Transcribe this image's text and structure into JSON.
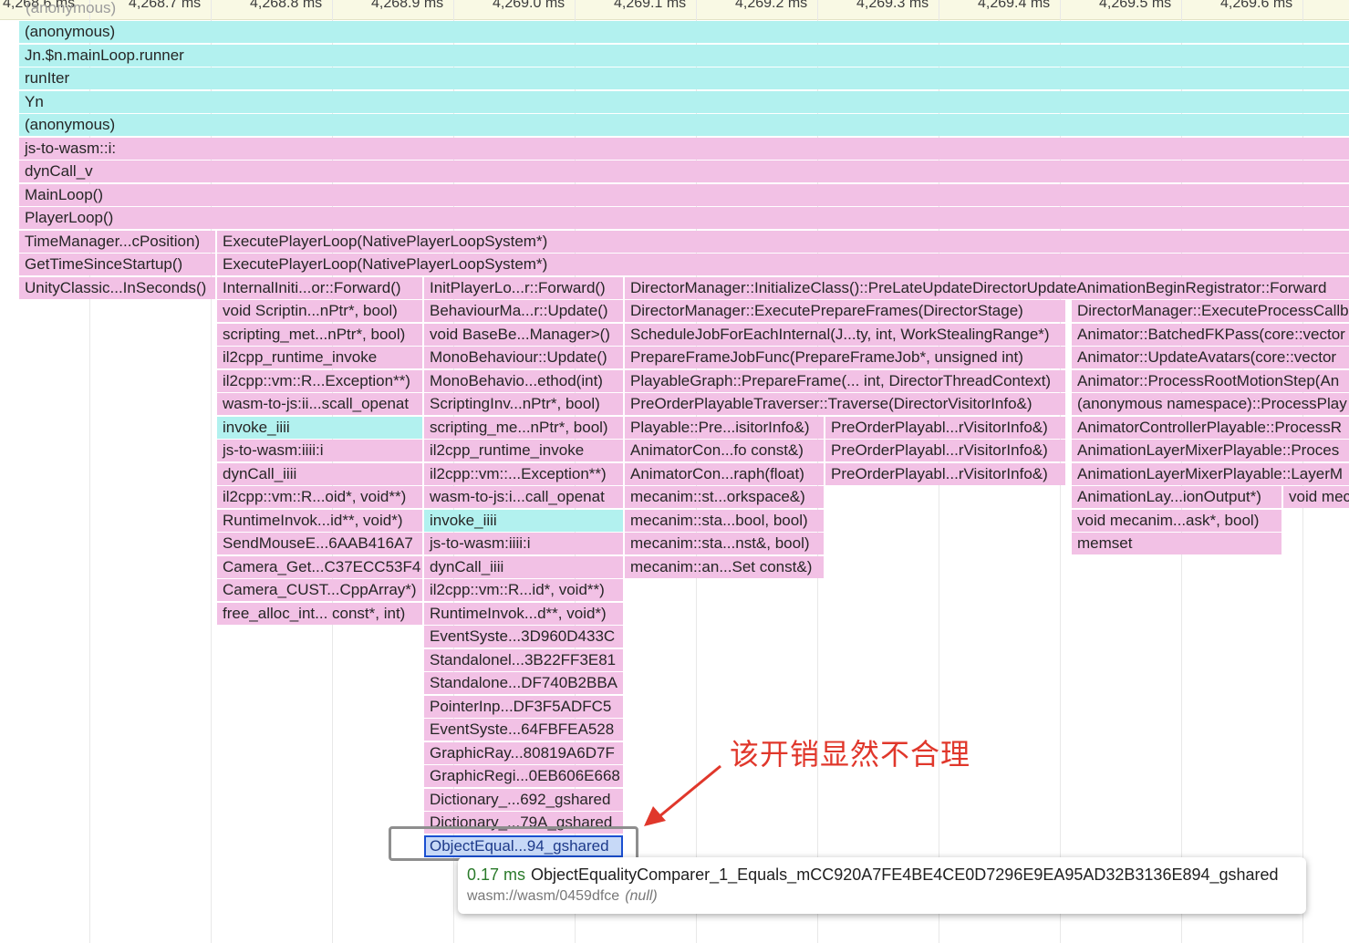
{
  "ruler": {
    "ticks": [
      "4,268.6 ms",
      "4,268.7 ms",
      "4,268.8 ms",
      "4,268.9 ms",
      "4,269.0 ms",
      "4,269.1 ms",
      "4,269.2 ms",
      "4,269.3 ms",
      "4,269.4 ms",
      "4,269.5 ms",
      "4,269.6 ms"
    ]
  },
  "ghost_label": "(anonymous)",
  "flame": {
    "columns": {
      "c0": [
        {
          "label": "(anonymous)",
          "color": "cyan"
        },
        {
          "label": "Jn.$n.mainLoop.runner",
          "color": "cyan"
        },
        {
          "label": "runIter",
          "color": "cyan"
        },
        {
          "label": "Yn",
          "color": "cyan"
        },
        {
          "label": "(anonymous)",
          "color": "cyan"
        },
        {
          "label": "js-to-wasm::i:",
          "color": "pink"
        },
        {
          "label": "dynCall_v",
          "color": "pink"
        },
        {
          "label": "MainLoop()",
          "color": "pink"
        },
        {
          "label": "PlayerLoop()",
          "color": "pink"
        },
        {
          "label": "TimeManager...cPosition)",
          "color": "pink"
        },
        {
          "label": "GetTimeSinceStartup()",
          "color": "pink"
        },
        {
          "label": "UnityClassic...InSeconds()",
          "color": "pink"
        }
      ],
      "c1_top": [
        {
          "label": "ExecutePlayerLoop(NativePlayerLoopSystem*)",
          "color": "pink"
        },
        {
          "label": "ExecutePlayerLoop(NativePlayerLoopSystem*)",
          "color": "pink"
        }
      ],
      "c1": [
        {
          "label": "InternalIniti...or::Forward()",
          "color": "pink"
        },
        {
          "label": "void Scriptin...nPtr*, bool)",
          "color": "pink"
        },
        {
          "label": "scripting_met...nPtr*, bool)",
          "color": "pink"
        },
        {
          "label": "il2cpp_runtime_invoke",
          "color": "pink"
        },
        {
          "label": "il2cpp::vm::R...Exception**)",
          "color": "pink"
        },
        {
          "label": "wasm-to-js:ii...scall_openat",
          "color": "pink"
        },
        {
          "label": "invoke_iiii",
          "color": "cyan"
        },
        {
          "label": "js-to-wasm:iiii:i",
          "color": "pink"
        },
        {
          "label": "dynCall_iiii",
          "color": "pink"
        },
        {
          "label": "il2cpp::vm::R...oid*, void**)",
          "color": "pink"
        },
        {
          "label": "RuntimeInvok...id**, void*)",
          "color": "pink"
        },
        {
          "label": "SendMouseE...6AAB416A7",
          "color": "pink"
        },
        {
          "label": "Camera_Get...C37ECC53F4",
          "color": "pink"
        },
        {
          "label": "Camera_CUST...CppArray*)",
          "color": "pink"
        },
        {
          "label": "free_alloc_int... const*, int)",
          "color": "pink"
        }
      ],
      "c2": [
        {
          "label": "InitPlayerLo...r::Forward()",
          "color": "pink"
        },
        {
          "label": "BehaviourMa...r::Update()",
          "color": "pink"
        },
        {
          "label": "void BaseBe...Manager>()",
          "color": "pink"
        },
        {
          "label": "MonoBehaviour::Update()",
          "color": "pink"
        },
        {
          "label": "MonoBehavio...ethod(int)",
          "color": "pink"
        },
        {
          "label": "ScriptingInv...nPtr*, bool)",
          "color": "pink"
        },
        {
          "label": "scripting_me...nPtr*, bool)",
          "color": "pink"
        },
        {
          "label": "il2cpp_runtime_invoke",
          "color": "pink"
        },
        {
          "label": "il2cpp::vm::...Exception**)",
          "color": "pink"
        },
        {
          "label": "wasm-to-js:i...call_openat",
          "color": "pink"
        },
        {
          "label": "invoke_iiii",
          "color": "cyan"
        },
        {
          "label": "js-to-wasm:iiii:i",
          "color": "pink"
        },
        {
          "label": "dynCall_iiii",
          "color": "pink"
        },
        {
          "label": "il2cpp::vm::R...id*, void**)",
          "color": "pink"
        },
        {
          "label": "RuntimeInvok...d**, void*)",
          "color": "pink"
        },
        {
          "label": "EventSyste...3D960D433C",
          "color": "pink"
        },
        {
          "label": "Standalonel...3B22FF3E81",
          "color": "pink"
        },
        {
          "label": "Standalone...DF740B2BBA",
          "color": "pink"
        },
        {
          "label": "PointerInp...DF3F5ADFC5",
          "color": "pink"
        },
        {
          "label": "EventSyste...64FBFEA528",
          "color": "pink"
        },
        {
          "label": "GraphicRay...80819A6D7F",
          "color": "pink"
        },
        {
          "label": "GraphicRegi...0EB606E668",
          "color": "pink"
        },
        {
          "label": "Dictionary_...692_gshared",
          "color": "pink"
        },
        {
          "label": "Dictionary_...79A_gshared",
          "color": "pink"
        },
        {
          "label": "ObjectEqual...94_gshared",
          "color": "selected"
        }
      ],
      "c3_wide": [
        {
          "label": "DirectorManager::InitializeClass()::PreLateUpdateDirectorUpdateAnimationBeginRegistrator::Forward",
          "color": "pink"
        }
      ],
      "c3": [
        {
          "label": "DirectorManager::ExecutePrepareFrames(DirectorStage)",
          "color": "pink"
        },
        {
          "label": "ScheduleJobForEachInternal(J...ty, int, WorkStealingRange*)",
          "color": "pink"
        },
        {
          "label": "PrepareFrameJobFunc(PrepareFrameJob*, unsigned int)",
          "color": "pink"
        },
        {
          "label": "PlayableGraph::PrepareFrame(... int, DirectorThreadContext)",
          "color": "pink"
        },
        {
          "label": "PreOrderPlayableTraverser::Traverse(DirectorVisitorInfo&)",
          "color": "pink"
        }
      ],
      "c3a": [
        {
          "label": "Playable::Pre...isitorInfo&)",
          "color": "pink"
        },
        {
          "label": "AnimatorCon...fo const&)",
          "color": "pink"
        },
        {
          "label": "AnimatorCon...raph(float)",
          "color": "pink"
        },
        {
          "label": "mecanim::st...orkspace&)",
          "color": "pink"
        },
        {
          "label": "mecanim::sta...bool, bool)",
          "color": "pink"
        },
        {
          "label": "mecanim::sta...nst&, bool)",
          "color": "pink"
        },
        {
          "label": "mecanim::an...Set const&)",
          "color": "pink"
        }
      ],
      "c3b": [
        {
          "label": "PreOrderPlayabl...rVisitorInfo&)",
          "color": "pink"
        },
        {
          "label": "PreOrderPlayabl...rVisitorInfo&)",
          "color": "pink"
        },
        {
          "label": "PreOrderPlayabl...rVisitorInfo&)",
          "color": "pink"
        }
      ],
      "c4": [
        {
          "label": "DirectorManager::ExecuteProcessCallb",
          "color": "pink"
        },
        {
          "label": "Animator::BatchedFKPass(core::vector",
          "color": "pink"
        },
        {
          "label": "Animator::UpdateAvatars(core::vector",
          "color": "pink"
        },
        {
          "label": "Animator::ProcessRootMotionStep(An",
          "color": "pink"
        },
        {
          "label": "(anonymous namespace)::ProcessPlay",
          "color": "pink"
        },
        {
          "label": "AnimatorControllerPlayable::ProcessR",
          "color": "pink"
        },
        {
          "label": "AnimationLayerMixerPlayable::Proces",
          "color": "pink"
        },
        {
          "label": "AnimationLayerMixerPlayable::LayerM",
          "color": "pink"
        }
      ],
      "c4a": [
        {
          "label": "AnimationLay...ionOutput*)",
          "color": "pink"
        },
        {
          "label": "void mecanim...ask*, bool)",
          "color": "pink"
        },
        {
          "label": "memset",
          "color": "pink"
        }
      ],
      "c4b": [
        {
          "label": "void mec",
          "color": "pink"
        }
      ]
    }
  },
  "annotation": {
    "text": "该开销显然不合理",
    "color": "#e0372b"
  },
  "tooltip": {
    "duration": "0.17 ms",
    "name": "ObjectEqualityComparer_1_Equals_mCC920A7FE4BE4CE0D7296E9EA95AD32B3136E894_gshared",
    "source": "wasm://wasm/0459dfce",
    "null_text": "(null)"
  }
}
